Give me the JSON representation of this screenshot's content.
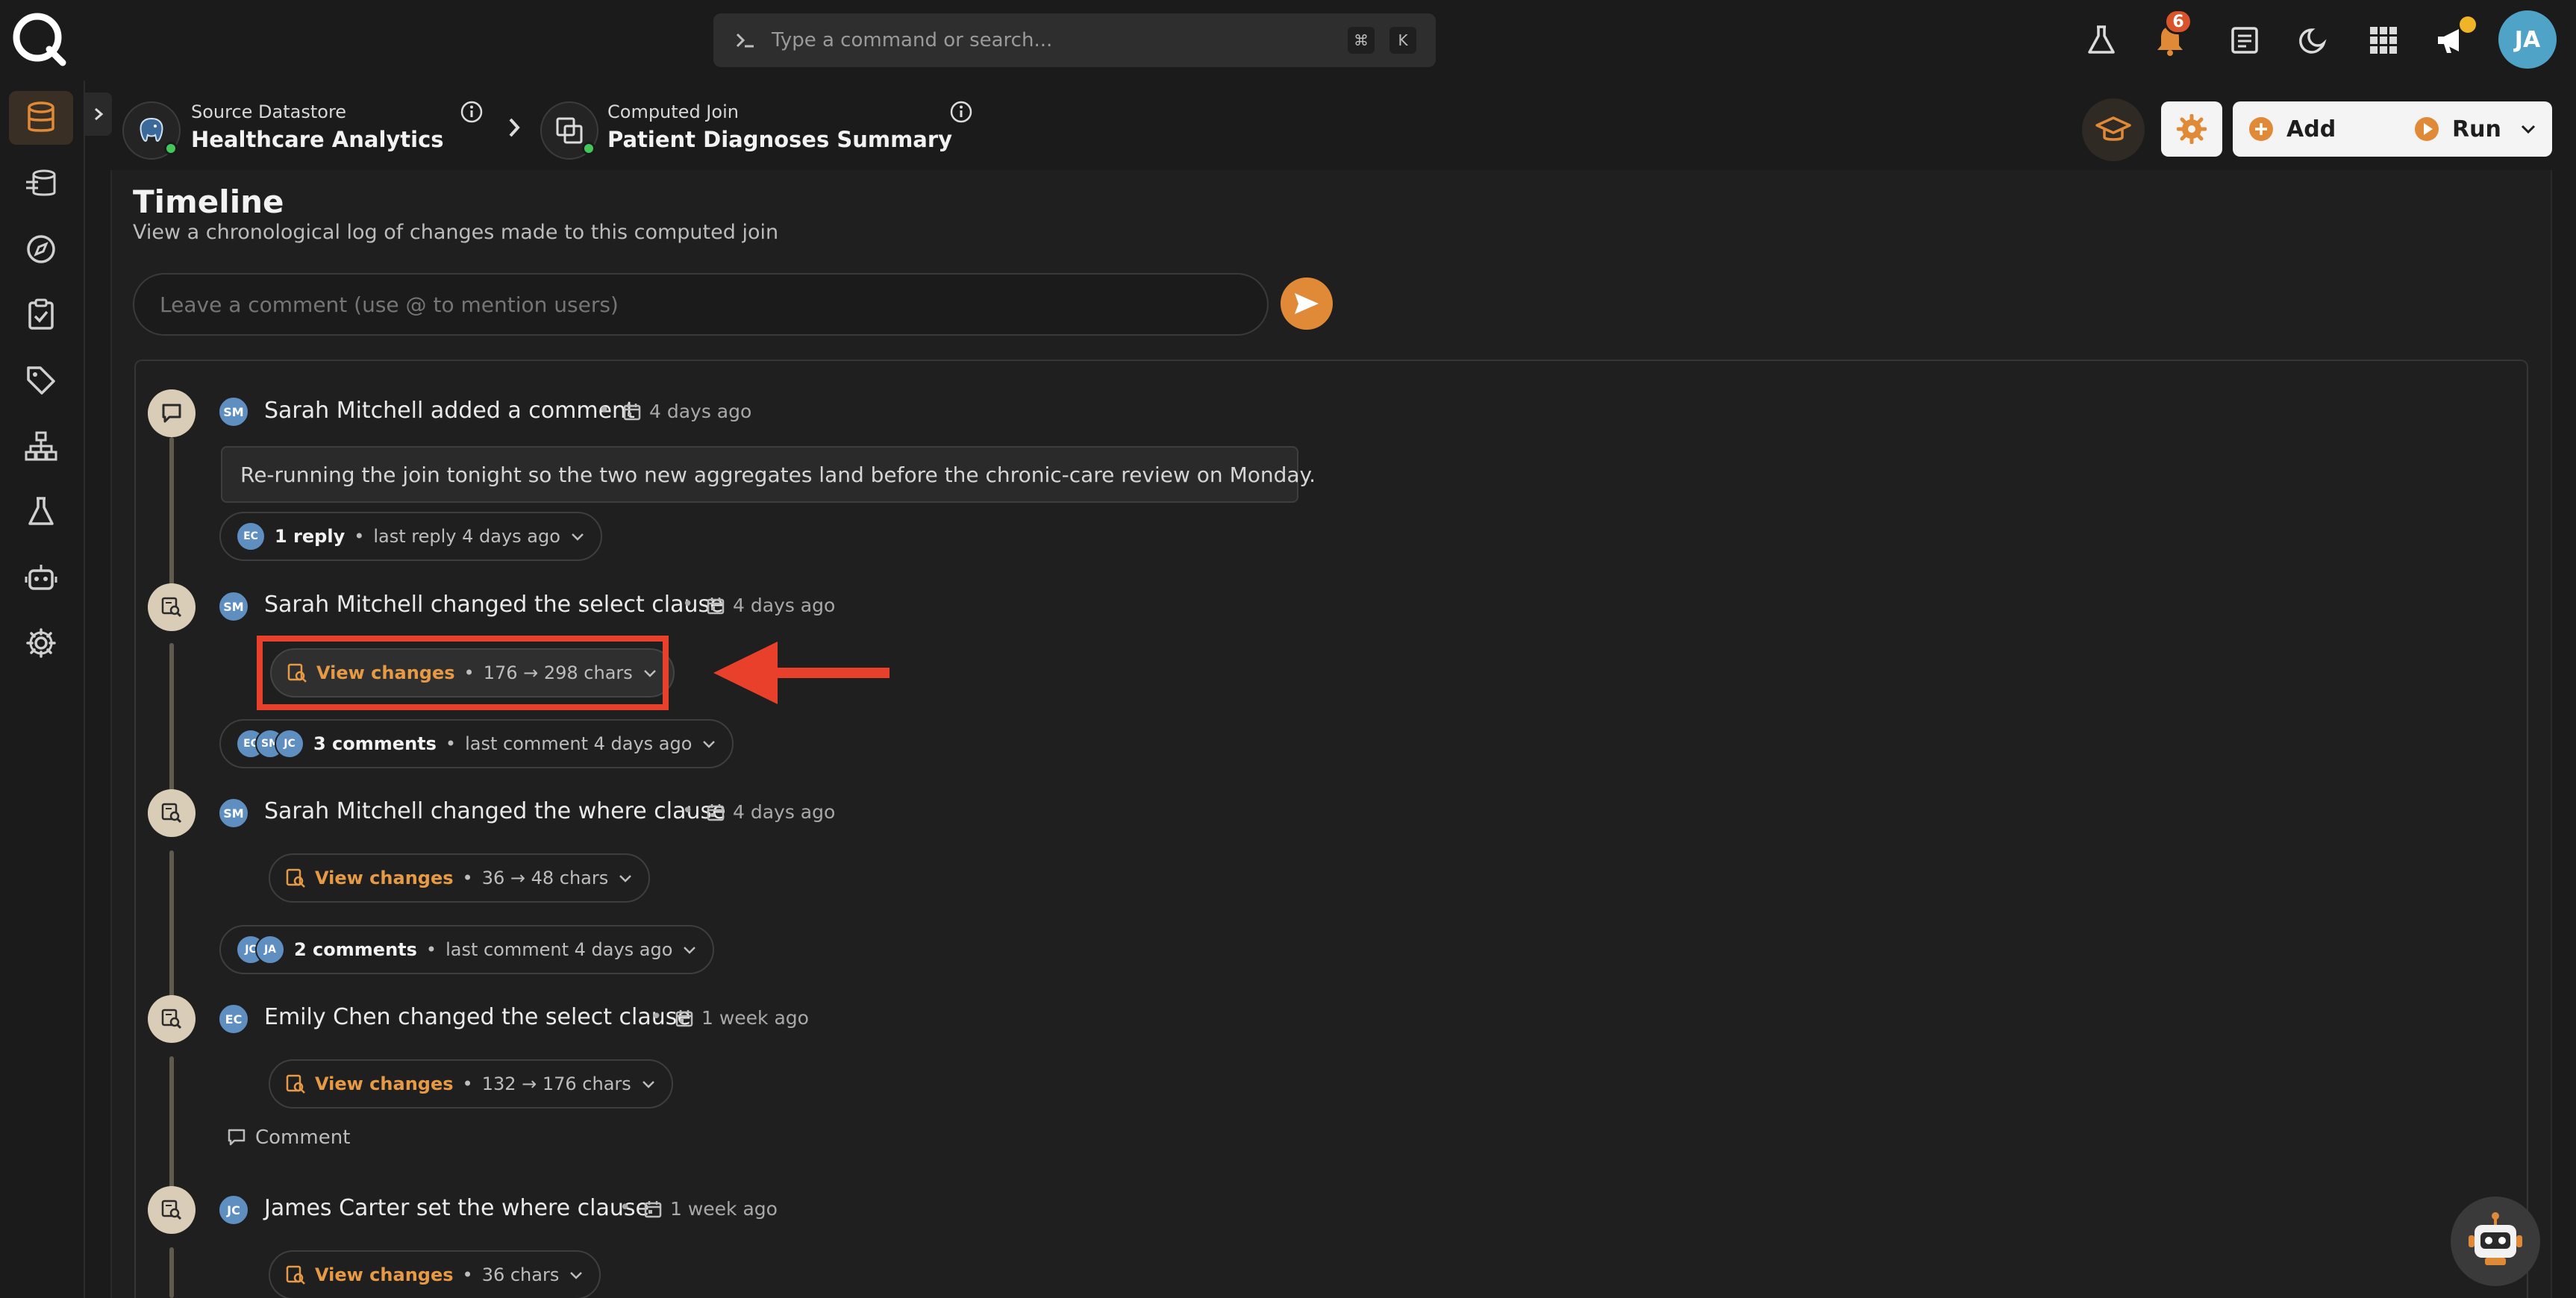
{
  "search": {
    "placeholder": "Type a command or search...",
    "shortcut_keys": [
      "⌘",
      "K"
    ]
  },
  "topbar": {
    "notification_count": "6",
    "user_initials": "JA"
  },
  "breadcrumb": {
    "source_label": "Source Datastore",
    "source_name": "Healthcare Analytics",
    "target_label": "Computed Join",
    "target_name": "Patient Diagnoses Summary"
  },
  "actions": {
    "add_label": "Add",
    "run_label": "Run"
  },
  "timeline": {
    "title": "Timeline",
    "description": "View a chronological log of changes made to this computed join",
    "comment_placeholder": "Leave a comment (use @ to mention users)"
  },
  "events": [
    {
      "avatar": "SM",
      "text": "Sarah Mitchell added a comment",
      "time": "4 days ago",
      "body": "Re-running the join tonight so the two new aggregates land before the chronic-care review on Monday.",
      "replies": {
        "avatars": [
          "EC"
        ],
        "label": "1 reply",
        "meta": "last reply 4 days ago"
      }
    },
    {
      "avatar": "SM",
      "text": "Sarah Mitchell changed the select clause",
      "time": "4 days ago",
      "changes": {
        "label": "View changes",
        "meta": "176 → 298 chars"
      },
      "comments": {
        "avatars": [
          "EC",
          "SM",
          "JC"
        ],
        "label": "3 comments",
        "meta": "last comment 4 days ago"
      }
    },
    {
      "avatar": "SM",
      "text": "Sarah Mitchell changed the where clause",
      "time": "4 days ago",
      "changes": {
        "label": "View changes",
        "meta": "36 → 48 chars"
      },
      "comments": {
        "avatars": [
          "JC",
          "JA"
        ],
        "label": "2 comments",
        "meta": "last comment 4 days ago"
      }
    },
    {
      "avatar": "EC",
      "text": "Emily Chen changed the select clause",
      "time": "1 week ago",
      "changes": {
        "label": "View changes",
        "meta": "132 → 176 chars"
      },
      "comment_link": "Comment"
    },
    {
      "avatar": "JC",
      "text": "James Carter set the where clause",
      "time": "1 week ago",
      "changes": {
        "label": "View changes",
        "meta": "36 chars"
      }
    }
  ],
  "colors": {
    "accent": "#e08a37",
    "highlight": "#e8402b",
    "avatar": "#5f8fc1"
  }
}
